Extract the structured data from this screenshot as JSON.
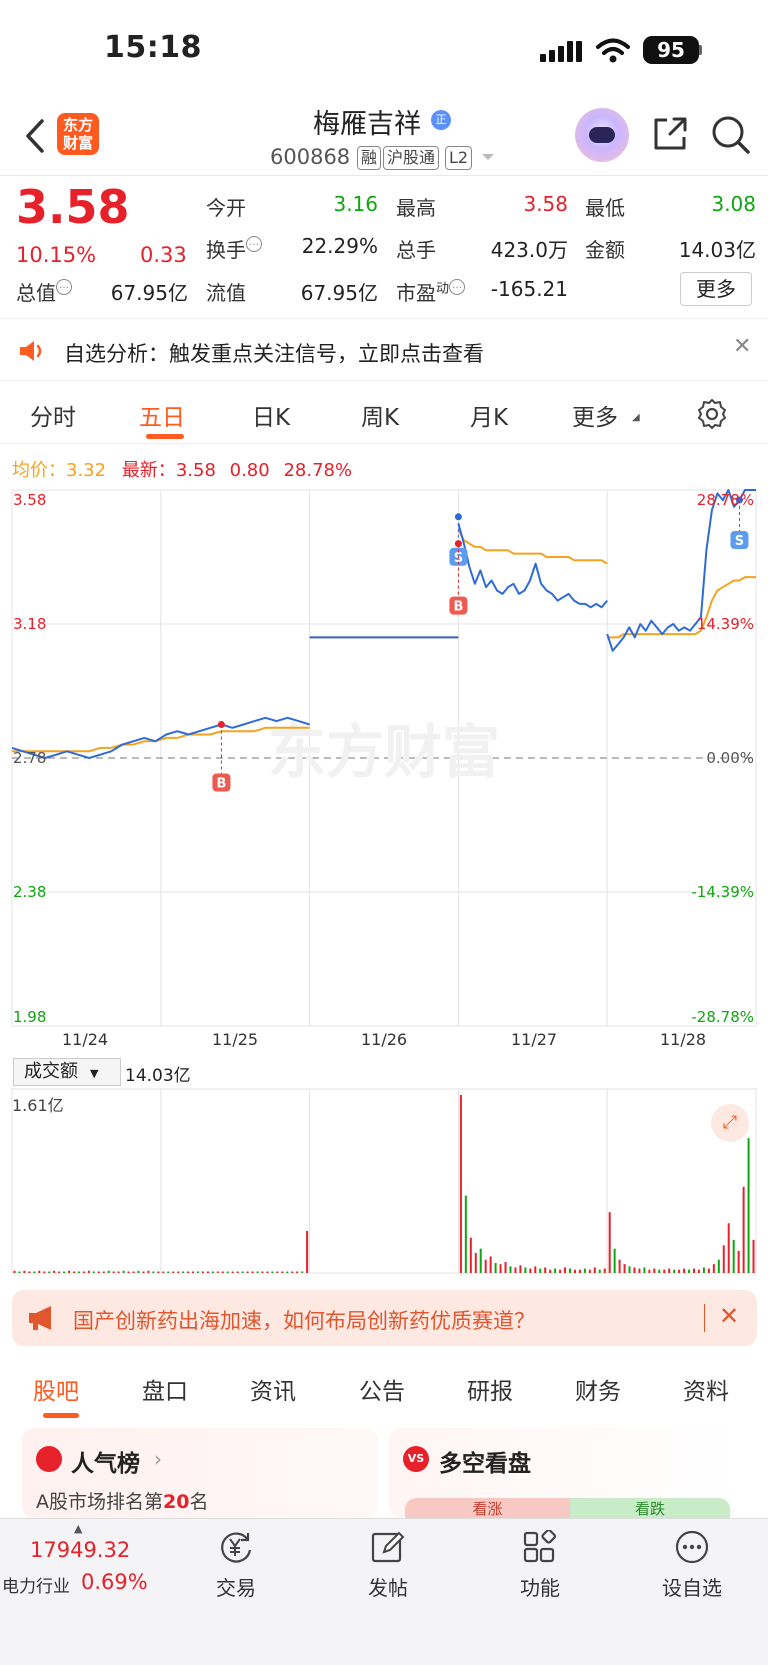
{
  "status_bar": {
    "time": "15:18",
    "battery": "95"
  },
  "header": {
    "logo_text": "东方财富",
    "stock_name": "梅雁吉祥",
    "name_badge": "正",
    "stock_code": "600868",
    "tags": [
      "融",
      "沪股通",
      "L2"
    ]
  },
  "quote": {
    "price": "3.58",
    "change_pct": "10.15%",
    "change_abs": "0.33",
    "fields": {
      "open_label": "今开",
      "open": "3.16",
      "high_label": "最高",
      "high": "3.58",
      "low_label": "最低",
      "low": "3.08",
      "turnover_label": "换手",
      "turnover": "22.29%",
      "volume_label": "总手",
      "volume": "423.0万",
      "amount_label": "金额",
      "amount": "14.03亿",
      "mktcap_label": "总值",
      "mktcap": "67.95亿",
      "float_label": "流值",
      "float": "67.95亿",
      "pe_label": "市盈",
      "pe_sup": "动",
      "pe": "-165.21"
    },
    "more_button": "更多"
  },
  "notice": {
    "text": "自选分析：触发重点关注信号，立即点击查看"
  },
  "chart_tabs": [
    "分时",
    "五日",
    "日K",
    "周K",
    "月K",
    "更多"
  ],
  "active_chart_tab": "五日",
  "chart_legend": {
    "avg_label": "均价：",
    "avg": "3.32",
    "latest_label": "最新：",
    "latest": "3.58",
    "change_abs": "0.80",
    "change_pct": "28.78%"
  },
  "watermark": "东方财富",
  "chart_data": {
    "type": "line",
    "x_labels": [
      "11/24",
      "11/25",
      "11/26",
      "11/27",
      "11/28"
    ],
    "y_ticks_left": [
      "3.58",
      "3.18",
      "2.78",
      "2.38",
      "1.98"
    ],
    "y_ticks_right": [
      "28.78%",
      "14.39%",
      "0.00%",
      "-14.39%",
      "-28.78%"
    ],
    "ylim": [
      1.98,
      3.58
    ],
    "prev_close": 2.78,
    "series": [
      {
        "name": "最新",
        "color": "#2f6bd8",
        "days": [
          [
            2.81,
            2.8,
            2.79,
            2.78,
            2.79,
            2.8,
            2.79,
            2.78,
            2.79,
            2.8,
            2.82,
            2.83,
            2.84,
            2.83,
            2.85,
            2.86,
            2.85,
            2.86,
            2.87,
            2.88,
            2.87,
            2.88,
            2.89,
            2.9,
            2.89,
            2.9,
            2.89,
            2.88
          ],
          [
            3.14,
            3.14,
            3.14,
            3.14,
            3.14,
            3.14,
            3.14,
            3.14,
            3.14,
            3.14,
            3.14,
            3.14,
            3.14,
            3.14,
            3.14,
            3.14,
            3.14,
            3.14,
            3.14,
            3.14,
            3.14,
            3.14,
            3.14,
            3.14,
            3.14,
            3.14,
            3.14,
            3.14
          ],
          [
            3.48,
            3.42,
            3.35,
            3.3,
            3.34,
            3.29,
            3.31,
            3.28,
            3.27,
            3.29,
            3.3,
            3.27,
            3.28,
            3.31,
            3.36,
            3.3,
            3.28,
            3.27,
            3.25,
            3.26,
            3.27,
            3.25,
            3.24,
            3.24,
            3.23,
            3.24,
            3.23,
            3.25
          ],
          [
            3.15,
            3.1,
            3.12,
            3.14,
            3.17,
            3.14,
            3.18,
            3.16,
            3.19,
            3.17,
            3.15,
            3.17,
            3.18,
            3.16,
            3.17,
            3.16,
            3.18,
            3.2,
            3.4,
            3.52,
            3.57,
            3.55,
            3.58,
            3.53,
            3.55,
            3.58,
            3.58,
            3.58
          ]
        ]
      },
      {
        "name": "均价",
        "color": "#f5a21f",
        "days": [
          [
            2.8,
            2.8,
            2.8,
            2.8,
            2.8,
            2.8,
            2.8,
            2.8,
            2.81,
            2.81,
            2.82,
            2.82,
            2.83,
            2.83,
            2.84,
            2.84,
            2.85,
            2.85,
            2.85,
            2.86,
            2.86,
            2.86,
            2.86,
            2.87,
            2.87,
            2.87,
            2.87,
            2.87
          ],
          [
            3.14,
            3.14,
            3.14,
            3.14,
            3.14,
            3.14,
            3.14,
            3.14,
            3.14,
            3.14,
            3.14,
            3.14,
            3.14,
            3.14,
            3.14,
            3.14,
            3.14,
            3.14,
            3.14,
            3.14,
            3.14,
            3.14,
            3.14,
            3.14,
            3.14,
            3.14,
            3.14,
            3.14
          ],
          [
            3.46,
            3.43,
            3.42,
            3.41,
            3.41,
            3.4,
            3.4,
            3.4,
            3.4,
            3.4,
            3.39,
            3.39,
            3.39,
            3.39,
            3.39,
            3.39,
            3.38,
            3.38,
            3.38,
            3.38,
            3.38,
            3.37,
            3.37,
            3.37,
            3.37,
            3.37,
            3.37,
            3.36
          ],
          [
            3.14,
            3.14,
            3.14,
            3.15,
            3.15,
            3.15,
            3.15,
            3.15,
            3.15,
            3.15,
            3.15,
            3.15,
            3.15,
            3.15,
            3.15,
            3.15,
            3.15,
            3.16,
            3.2,
            3.25,
            3.28,
            3.29,
            3.3,
            3.31,
            3.31,
            3.32,
            3.32,
            3.32
          ]
        ]
      }
    ],
    "trade_markers": [
      {
        "label": "B",
        "day": 0,
        "index": 19,
        "price": 2.88
      },
      {
        "label": "S",
        "day": 2,
        "index": 0,
        "price": 3.5
      },
      {
        "label": "B",
        "day": 2,
        "index": 0,
        "price": 3.42
      },
      {
        "label": "S",
        "day": 3,
        "index": 24,
        "price": 3.55
      }
    ]
  },
  "volume_panel": {
    "selector": "成交额",
    "total": "14.03亿",
    "max_label": "1.61亿"
  },
  "volume_data": {
    "unit": "亿",
    "max": 1.61,
    "days": [
      [
        0.02,
        0.01,
        0.02,
        0.01,
        0.01,
        0.02,
        0.01,
        0.01,
        0.02,
        0.01,
        0.01,
        0.02,
        0.01,
        0.01,
        0.01,
        0.02,
        0.01,
        0.01,
        0.01,
        0.02,
        0.01,
        0.01,
        0.02,
        0.01,
        0.01,
        0.02,
        0.01,
        0.02,
        0.01,
        0.01
      ],
      [
        0.01,
        0.01,
        0.01,
        0.01,
        0.01,
        0.01,
        0.01,
        0.01,
        0.01,
        0.01,
        0.01,
        0.01,
        0.01,
        0.01,
        0.01,
        0.01,
        0.01,
        0.01,
        0.01,
        0.01,
        0.01,
        0.01,
        0.01,
        0.01,
        0.01,
        0.01,
        0.01,
        0.01,
        0.01,
        0.38
      ],
      [
        1.61,
        0.7,
        0.32,
        0.18,
        0.22,
        0.12,
        0.15,
        0.09,
        0.08,
        0.1,
        0.06,
        0.05,
        0.07,
        0.05,
        0.04,
        0.06,
        0.04,
        0.05,
        0.03,
        0.04,
        0.03,
        0.05,
        0.04,
        0.03,
        0.03,
        0.04,
        0.03,
        0.05,
        0.03,
        0.04
      ],
      [
        0.55,
        0.22,
        0.12,
        0.08,
        0.06,
        0.05,
        0.04,
        0.05,
        0.03,
        0.04,
        0.03,
        0.03,
        0.04,
        0.03,
        0.03,
        0.04,
        0.03,
        0.04,
        0.03,
        0.05,
        0.04,
        0.08,
        0.12,
        0.25,
        0.45,
        0.3,
        0.2,
        0.78,
        1.22,
        0.3
      ]
    ]
  },
  "promo": {
    "text": "国产创新药出海加速，如何布局创新药优质赛道？"
  },
  "bottom_tabs": [
    "股吧",
    "盘口",
    "资讯",
    "公告",
    "研报",
    "财务",
    "资料"
  ],
  "active_bottom_tab": "股吧",
  "cards": {
    "popularity": {
      "title": "人气榜",
      "subtitle_prefix": "A股市场排名第",
      "rank": "20",
      "subtitle_suffix": "名"
    },
    "sentiment": {
      "icon": "VS",
      "title": "多空看盘",
      "up": "看涨",
      "down": "看跌"
    }
  },
  "bottom_bar": {
    "index_value": "17949.32",
    "sector_name": "电力行业",
    "sector_change": "0.69%",
    "nav": [
      {
        "icon": "yen-exchange-icon",
        "label": "交易"
      },
      {
        "icon": "edit-icon",
        "label": "发帖"
      },
      {
        "icon": "grid-icon",
        "label": "功能"
      },
      {
        "icon": "more-circle-icon",
        "label": "设自选"
      }
    ]
  },
  "colors": {
    "up": "#e6212a",
    "down": "#0fa60f",
    "price_line": "#2f6bd8",
    "avg_line": "#f5a21f",
    "accent": "#ff5a1f"
  }
}
